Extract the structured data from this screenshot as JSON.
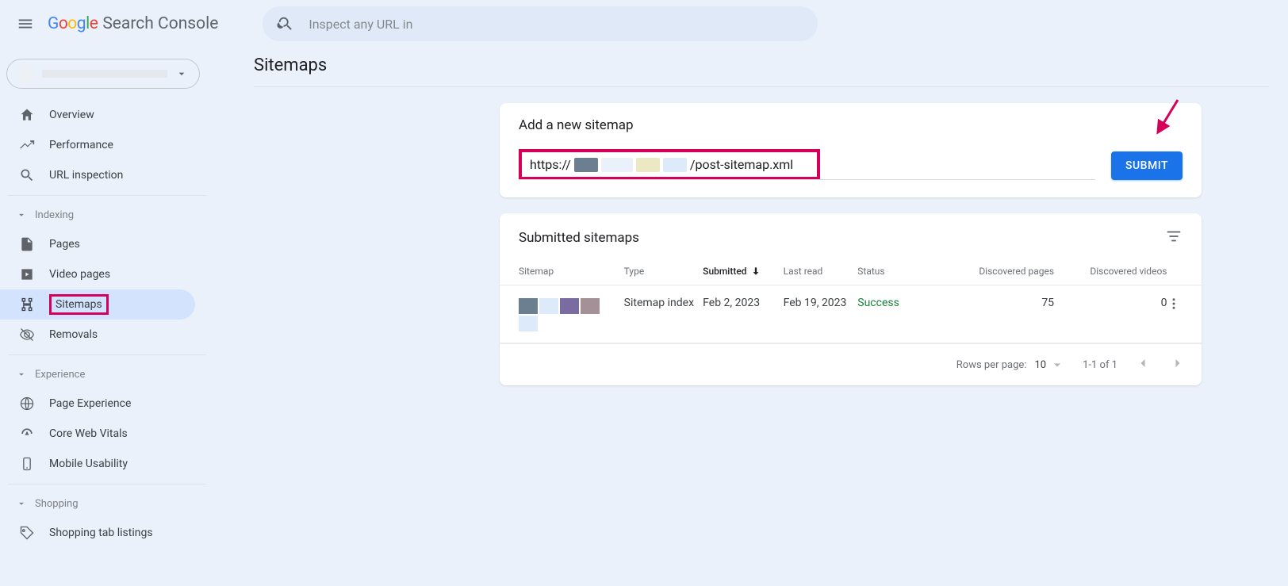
{
  "header": {
    "brand_suffix": "Search Console",
    "search_placeholder": "Inspect any URL in"
  },
  "sidebar": {
    "items_top": [
      {
        "label": "Overview"
      },
      {
        "label": "Performance"
      },
      {
        "label": "URL inspection"
      }
    ],
    "section_indexing": "Indexing",
    "items_indexing": [
      {
        "label": "Pages"
      },
      {
        "label": "Video pages"
      },
      {
        "label": "Sitemaps",
        "active": true,
        "highlighted": true
      },
      {
        "label": "Removals"
      }
    ],
    "section_experience": "Experience",
    "items_experience": [
      {
        "label": "Page Experience"
      },
      {
        "label": "Core Web Vitals"
      },
      {
        "label": "Mobile Usability"
      }
    ],
    "section_shopping": "Shopping",
    "items_shopping": [
      {
        "label": "Shopping tab listings"
      }
    ]
  },
  "page": {
    "title": "Sitemaps"
  },
  "add_card": {
    "heading": "Add a new sitemap",
    "prefix": "https://",
    "suffix": "/post-sitemap.xml",
    "submit": "SUBMIT"
  },
  "list_card": {
    "heading": "Submitted sitemaps",
    "columns": {
      "sitemap": "Sitemap",
      "type": "Type",
      "submitted": "Submitted",
      "last_read": "Last read",
      "status": "Status",
      "disc_pages": "Discovered pages",
      "disc_videos": "Discovered videos"
    },
    "rows": [
      {
        "type": "Sitemap index",
        "submitted": "Feb 2, 2023",
        "last_read": "Feb 19, 2023",
        "status": "Success",
        "disc_pages": "75",
        "disc_videos": "0"
      }
    ],
    "pager": {
      "rpp_label": "Rows per page:",
      "rpp_value": "10",
      "range": "1-1 of 1"
    }
  }
}
